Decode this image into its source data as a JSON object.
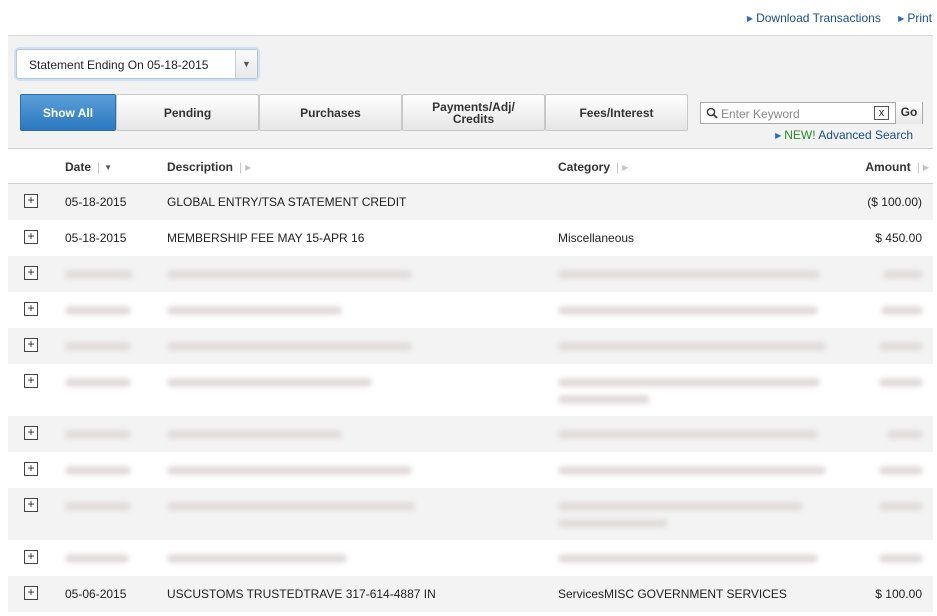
{
  "toplinks": {
    "download": "Download Transactions",
    "print": "Print"
  },
  "statement_select": {
    "value": "Statement Ending On 05-18-2015"
  },
  "tabs": [
    {
      "label": "Show All",
      "active": true
    },
    {
      "label": "Pending",
      "active": false
    },
    {
      "label": "Purchases",
      "active": false
    },
    {
      "label": "Payments/Adj/ Credits",
      "active": false
    },
    {
      "label": "Fees/Interest",
      "active": false
    }
  ],
  "search": {
    "placeholder": "Enter Keyword",
    "clear_label": "x",
    "go_label": "Go"
  },
  "advanced": {
    "new_label": "NEW!",
    "link_label": "Advanced Search"
  },
  "table": {
    "headers": {
      "date": "Date",
      "description": "Description",
      "category": "Category",
      "amount": "Amount"
    },
    "rows": [
      {
        "date": "05-18-2015",
        "description": "GLOBAL ENTRY/TSA STATEMENT CREDIT",
        "category": "",
        "amount": "($ 100.00)"
      },
      {
        "date": "05-18-2015",
        "description": "MEMBERSHIP FEE MAY 15-APR 16",
        "category": "Miscellaneous",
        "amount": "$ 450.00"
      },
      {
        "date": "05-06-2015",
        "description": "USCUSTOMS TRUSTEDTRAVE 317-614-4887 IN",
        "category": "ServicesMISC GOVERNMENT SERVICES",
        "amount": "$ 100.00"
      }
    ]
  }
}
